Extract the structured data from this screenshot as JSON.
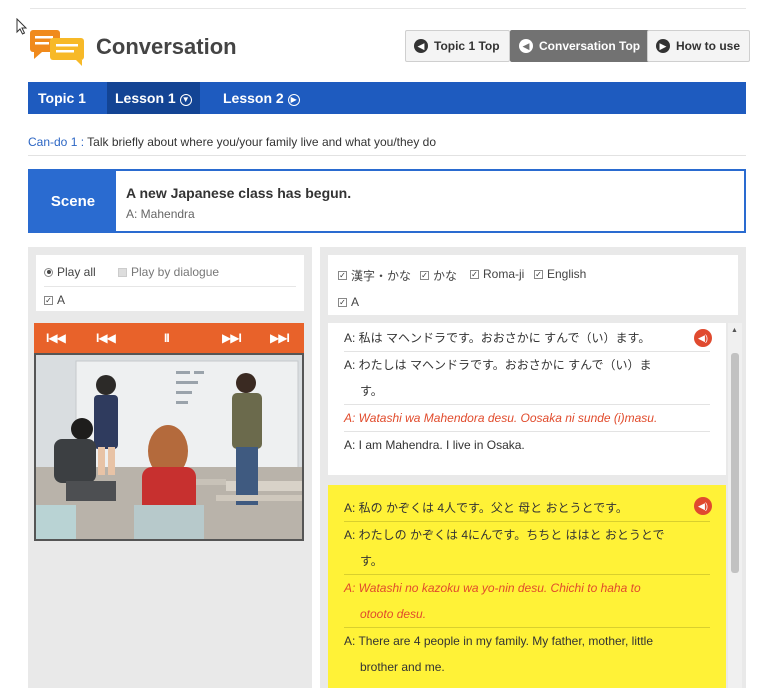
{
  "header": {
    "title": "Conversation",
    "buttons": [
      {
        "label": "Topic 1 Top",
        "icon": "left-circle-arrow-icon"
      },
      {
        "label": "Conversation Top",
        "icon": "left-circle-arrow-icon"
      },
      {
        "label": "How to use",
        "icon": "right-circle-arrow-icon"
      }
    ]
  },
  "nav": {
    "topic": "Topic 1",
    "lesson1": "Lesson 1",
    "lesson2": "Lesson 2"
  },
  "cando": {
    "label": "Can-do 1 :",
    "text": "Talk briefly about where you/your family live and what you/they do"
  },
  "scene": {
    "tag": "Scene",
    "title": "A new Japanese class has begun.",
    "speaker": "A: Mahendra"
  },
  "player_options": {
    "play_all": "Play all",
    "play_by_dialogue": "Play by dialogue",
    "speaker_a": "A"
  },
  "controls": {
    "first": "I◀◀",
    "prev": "I◀◀",
    "pause": "II",
    "next": "▶▶I",
    "last": "▶▶I"
  },
  "lang_options": {
    "kanji_kana": "漢字・かな",
    "kana": "かな",
    "romaji": "Roma-ji",
    "english": "English",
    "speaker_a": "A"
  },
  "dialogues": [
    {
      "kanji": "A: 私は マヘンドラです。おおさかに すんで（い）ます。",
      "kana_1": "A: わたしは マヘンドラです。おおさかに すんで（い）ま",
      "kana_2": "す。",
      "romaji": "A: Watashi wa Mahendora desu. Oosaka ni sunde (i)masu.",
      "english": "A: I am Mahendra. I live in Osaka."
    },
    {
      "kanji": "A: 私の かぞくは 4人です。父と 母と おとうとです。",
      "kana_1": "A: わたしの かぞくは 4にんです。ちちと ははと おとうとで",
      "kana_2": "す。",
      "romaji_1": "A: Watashi no kazoku wa yo-nin desu. Chichi to haha to",
      "romaji_2": "otooto desu.",
      "english_1": "A: There are 4 people in my family. My father, mother, little",
      "english_2": "brother and me."
    }
  ],
  "colors": {
    "nav_blue": "#1e5bbf",
    "scene_blue": "#2a6bd0",
    "player_orange": "#e8622a",
    "highlight_yellow": "#fff237",
    "romaji_red": "#e14b2c"
  }
}
